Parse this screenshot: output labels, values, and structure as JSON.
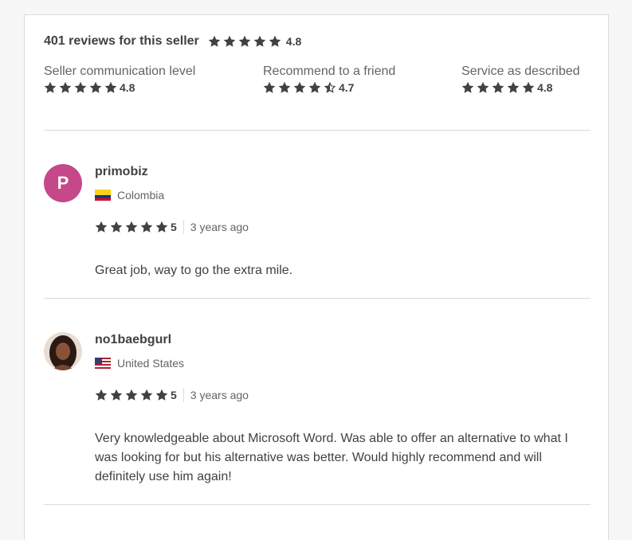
{
  "summary": {
    "title": "401 reviews for this seller",
    "overall_rating": "4.8"
  },
  "breakdown": [
    {
      "label": "Seller communication level",
      "rating": "4.8",
      "stars": 5
    },
    {
      "label": "Recommend to a friend",
      "rating": "4.7",
      "stars": 4.5
    },
    {
      "label": "Service as described",
      "rating": "4.8",
      "stars": 5
    }
  ],
  "reviews": [
    {
      "username": "primobiz",
      "avatar_letter": "P",
      "avatar_color": "#c4488a",
      "country": "Colombia",
      "flag_icon": "colombia-flag-icon",
      "rating": "5",
      "time": "3 years ago",
      "text": "Great job, way to go the extra mile."
    },
    {
      "username": "no1baebgurl",
      "avatar_icon": "user-photo-avatar",
      "country": "United States",
      "flag_icon": "us-flag-icon",
      "rating": "5",
      "time": "3 years ago",
      "text": "Very knowledgeable about Microsoft Word. Was able to offer an alternative to what I was looking for but his alternative was better. Would highly recommend and will definitely use him again!"
    }
  ]
}
